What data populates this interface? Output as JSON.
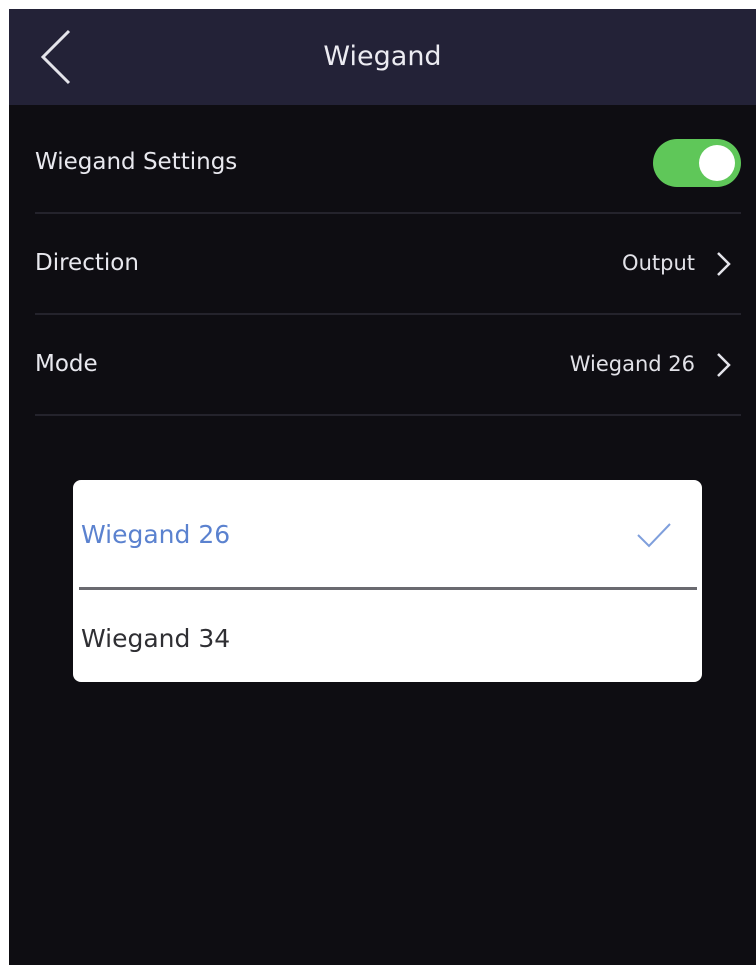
{
  "header": {
    "title": "Wiegand",
    "back_icon": "chevron-left-icon"
  },
  "settings": {
    "wiegand_settings": {
      "label": "Wiegand Settings",
      "enabled": true,
      "toggle_color": "#5fc759"
    },
    "direction": {
      "label": "Direction",
      "value": "Output",
      "icon": "chevron-right-icon"
    },
    "mode": {
      "label": "Mode",
      "value": "Wiegand 26",
      "icon": "chevron-right-icon"
    }
  },
  "mode_picker": {
    "options": [
      {
        "label": "Wiegand 26",
        "selected": true
      },
      {
        "label": "Wiegand 34",
        "selected": false
      }
    ],
    "selected_color": "#5b82cf",
    "check_icon": "checkmark-icon"
  },
  "colors": {
    "background": "#0e0d12",
    "header": "#232237"
  }
}
